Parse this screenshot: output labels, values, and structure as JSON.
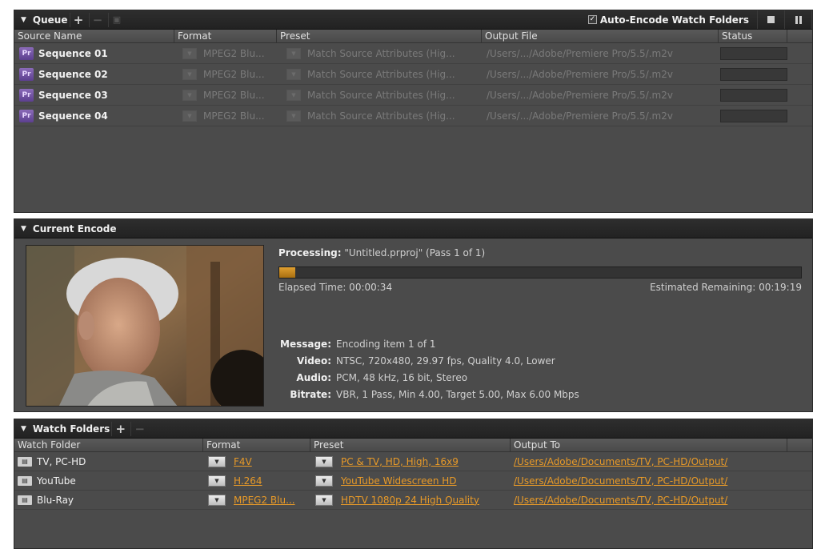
{
  "queue": {
    "title": "Queue",
    "add_icon": "plus-icon",
    "auto_encode_label": "Auto-Encode Watch Folders",
    "auto_encode_checked": true,
    "columns": [
      "Source Name",
      "Format",
      "Preset",
      "Output File",
      "Status"
    ],
    "items": [
      {
        "name": "Sequence 01",
        "format": "MPEG2 Blu...",
        "preset": "Match Source Attributes (Hig...",
        "output": "/Users/.../Adobe/Premiere Pro/5.5/.m2v"
      },
      {
        "name": "Sequence 02",
        "format": "MPEG2 Blu...",
        "preset": "Match Source Attributes (Hig...",
        "output": "/Users/.../Adobe/Premiere Pro/5.5/.m2v"
      },
      {
        "name": "Sequence 03",
        "format": "MPEG2 Blu...",
        "preset": "Match Source Attributes (Hig...",
        "output": "/Users/.../Adobe/Premiere Pro/5.5/.m2v"
      },
      {
        "name": "Sequence 04",
        "format": "MPEG2 Blu...",
        "preset": "Match Source Attributes (Hig...",
        "output": "/Users/.../Adobe/Premiere Pro/5.5/.m2v"
      }
    ],
    "badge_text": "Pr"
  },
  "current_encode": {
    "title": "Current Encode",
    "processing_label": "Processing:",
    "processing_value": "\"Untitled.prproj\" (Pass 1 of 1)",
    "progress_fraction": 0.03,
    "elapsed": "Elapsed Time: 00:00:34",
    "remaining": "Estimated Remaining: 00:19:19",
    "info": [
      {
        "label": "Message:",
        "value": "Encoding item 1 of 1"
      },
      {
        "label": "Video:",
        "value": "NTSC, 720x480, 29.97 fps, Quality 4.0, Lower"
      },
      {
        "label": "Audio:",
        "value": "PCM, 48 kHz, 16 bit, Stereo"
      },
      {
        "label": "Bitrate:",
        "value": "VBR, 1 Pass, Min 4.00, Target 5.00, Max 6.00 Mbps"
      }
    ]
  },
  "watch_folders": {
    "title": "Watch Folders",
    "columns": [
      "Watch Folder",
      "Format",
      "Preset",
      "Output To"
    ],
    "items": [
      {
        "name": "TV, PC-HD",
        "format": "F4V",
        "preset": "PC & TV, HD, High, 16x9",
        "output": "/Users/Adobe/Documents/TV, PC-HD/Output/"
      },
      {
        "name": "YouTube",
        "format": "H.264",
        "preset": "YouTube Widescreen HD",
        "output": "/Users/Adobe/Documents/TV, PC-HD/Output/"
      },
      {
        "name": "Blu-Ray",
        "format": "MPEG2 Blu...",
        "preset": "HDTV 1080p 24 High Quality",
        "output": "/Users/Adobe/Documents/TV, PC-HD/Output/"
      }
    ]
  },
  "colors": {
    "accent_orange": "#e89a28",
    "progress_fill": "#c98a1a"
  }
}
